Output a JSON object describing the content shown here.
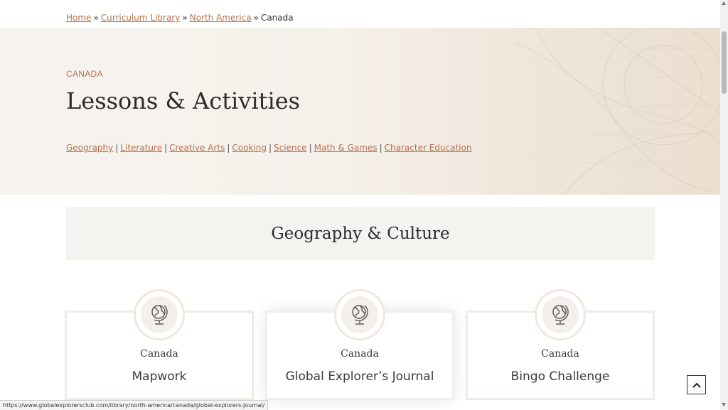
{
  "breadcrumb": {
    "items": [
      "Home",
      "Curriculum Library",
      "North America"
    ],
    "current": "Canada",
    "separator": "»"
  },
  "hero": {
    "kicker": "CANADA",
    "title": "Lessons & Activities",
    "subnav": [
      "Geography",
      "Literature",
      "Creative Arts",
      "Cooking",
      "Science",
      "Math & Games",
      "Character Education"
    ],
    "separator": "|"
  },
  "section": {
    "title": "Geography & Culture"
  },
  "cards": [
    {
      "region": "Canada",
      "title": "Mapwork",
      "icon": "globe-icon"
    },
    {
      "region": "Canada",
      "title": "Global Explorer’s Journal",
      "icon": "globe-icon"
    },
    {
      "region": "Canada",
      "title": "Bingo Challenge",
      "icon": "globe-icon"
    }
  ],
  "status_url": "https://www.globalexplorersclub.com/library/north-america/canada/global-explorers-journal/",
  "colors": {
    "accent": "#b5714a",
    "hero_bg": "#f5f1eb",
    "section_bg": "#f5f3ef",
    "card_border": "#f0ebe4"
  }
}
